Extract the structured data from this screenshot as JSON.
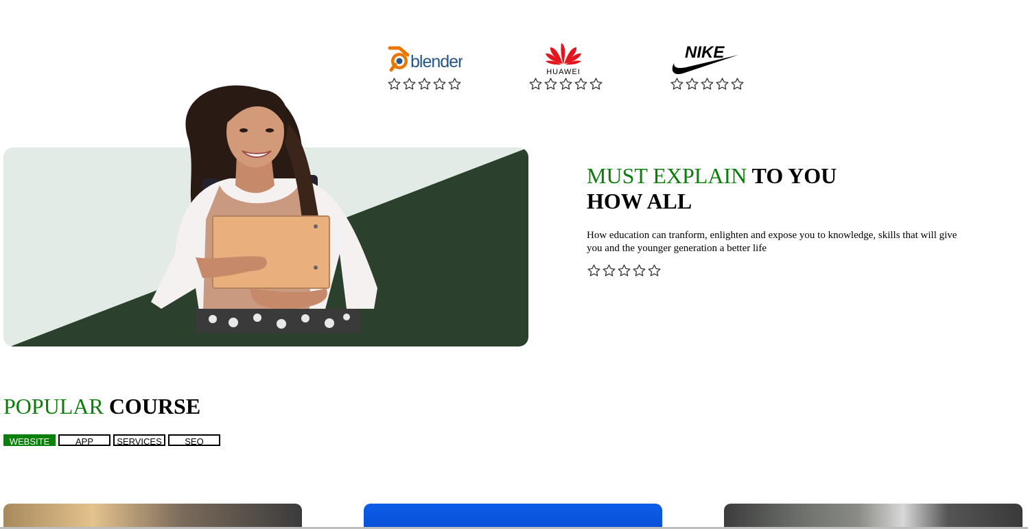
{
  "brands": [
    {
      "name": "blender",
      "label": "blender",
      "rating": 0
    },
    {
      "name": "huawei",
      "label": "HUAWEI",
      "rating": 0
    },
    {
      "name": "nike",
      "label": "NIKE",
      "rating": 0
    }
  ],
  "hero": {
    "title_green": "MUST EXPLAIN",
    "title_rest_line1": " TO YOU",
    "title_line2": "HOW ALL",
    "description": "How education can tranform, enlighten and expose you to knowledge, skills that will give you and the younger generation a better life",
    "rating": 0
  },
  "popular": {
    "title_green": "POPULAR",
    "title_rest": " COURSE",
    "tabs": [
      {
        "label": "WEBSITE",
        "active": true
      },
      {
        "label": "APP",
        "active": false
      },
      {
        "label": "SERVICES",
        "active": false
      },
      {
        "label": "SEO",
        "active": false
      }
    ]
  },
  "colors": {
    "accent_green": "#0a7d0a",
    "hero_dark": "#2c412d",
    "hero_light": "#e3ebe6"
  }
}
